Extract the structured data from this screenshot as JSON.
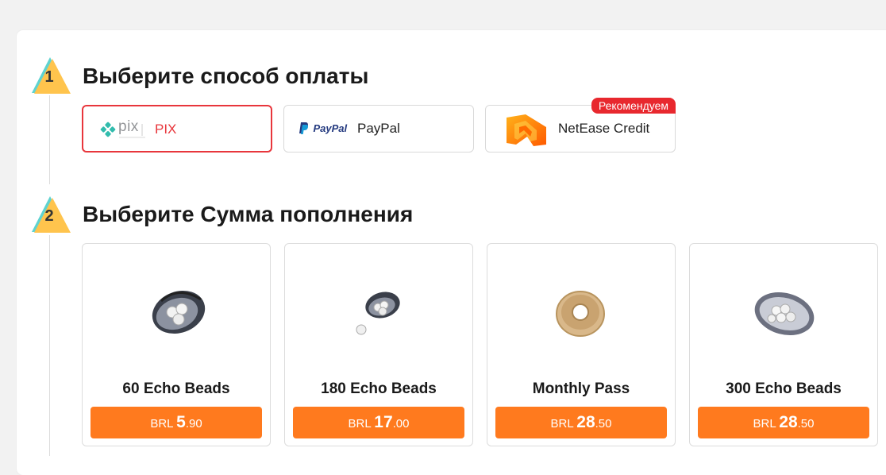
{
  "steps": [
    {
      "number": "1",
      "title": "Выберите способ оплаты"
    },
    {
      "number": "2",
      "title": "Выберите Сумма пополнения"
    }
  ],
  "payment_methods": [
    {
      "label": "PIX",
      "logo_text": "pix",
      "icon": "pix-logo-icon",
      "selected": true
    },
    {
      "label": "PayPal",
      "logo_text": "PayPal",
      "icon": "paypal-logo-icon",
      "selected": false
    },
    {
      "label": "NetEase Credit",
      "icon": "netease-credit-logo-icon",
      "selected": false,
      "badge": "Рекомендуем"
    }
  ],
  "products": [
    {
      "name": "60 Echo Beads",
      "currency": "BRL",
      "price_int": "5",
      "price_dec": ".90",
      "icon": "pearl-shell-icon"
    },
    {
      "name": "180 Echo Beads",
      "currency": "BRL",
      "price_int": "17",
      "price_dec": ".00",
      "icon": "pearl-shell-small-icon"
    },
    {
      "name": "Monthly Pass",
      "currency": "BRL",
      "price_int": "28",
      "price_dec": ".50",
      "icon": "monthly-pass-disc-icon"
    },
    {
      "name": "300 Echo Beads",
      "currency": "BRL",
      "price_int": "28",
      "price_dec": ".50",
      "icon": "pearl-shell-open-icon"
    }
  ],
  "colors": {
    "accent": "#ff7a1e",
    "selected_border": "#e8363c",
    "badge": "#e8282e",
    "step_yellow": "#ffc44d",
    "step_teal": "#5fd3d0"
  }
}
